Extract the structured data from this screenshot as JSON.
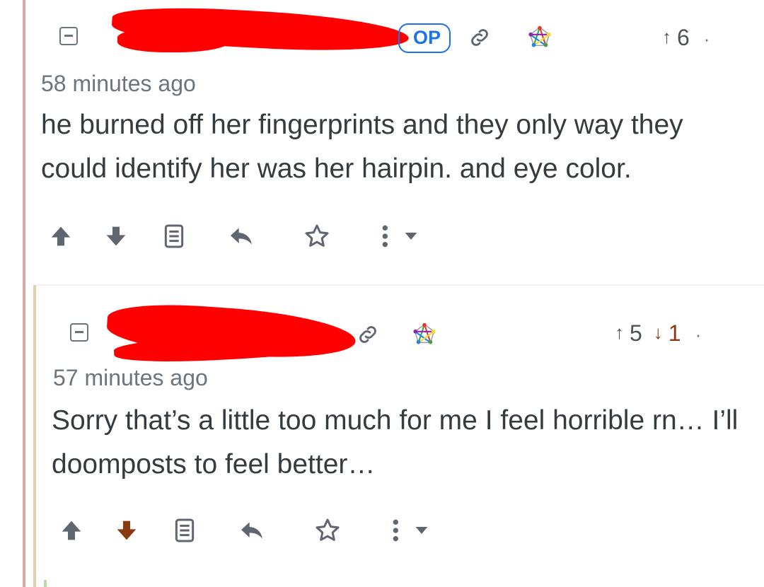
{
  "comments": [
    {
      "is_op": true,
      "op_badge": "OP",
      "score_up": "6",
      "score_down": "",
      "time_ago": "58 minutes ago",
      "body": "he burned off her fingerprints and they only way they could identify her was her hairpin. and eye color.",
      "rail_color": "#d9aaa8",
      "voted": "none"
    },
    {
      "is_op": false,
      "score_up": "5",
      "score_down": "1",
      "time_ago": "57 minutes ago",
      "body": "Sorry that’s a little too much for me I feel horrible rn… I’ll doomposts to feel better…",
      "rail_color": "#dcd4a8",
      "voted": "down"
    }
  ],
  "meta_glyphs": {
    "up_arrow": "↑",
    "down_arrow": "↓",
    "more_dot": "·"
  },
  "colors": {
    "op_blue": "#1a73e8",
    "downvote_active": "#8a3a10",
    "icon_gray": "#5f6670",
    "third_rail": "#b8dba8"
  }
}
